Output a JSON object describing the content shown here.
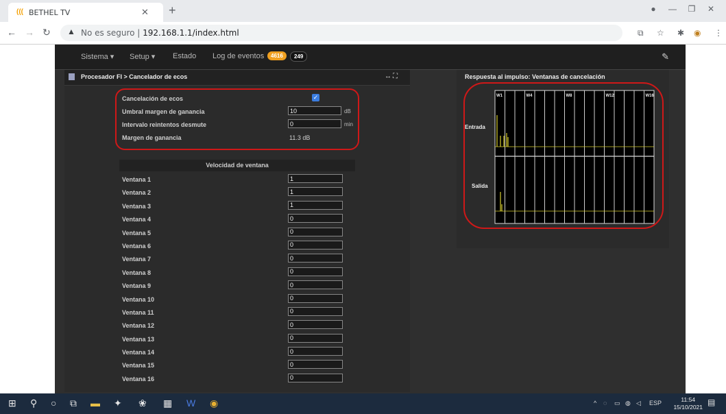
{
  "browser": {
    "tab_title": "BETHEL TV",
    "tab_icon_text": "(((",
    "security_label": "No es seguro",
    "url": "192.168.1.1/index.html"
  },
  "nav": {
    "items": [
      "Sistema ▾",
      "Setup ▾",
      "Estado",
      "Log de eventos"
    ],
    "badge_orange": "4616",
    "badge_dark": "249",
    "colors": {
      "orange": "#f0a020",
      "dark": "#1a1a1a"
    }
  },
  "left_panel": {
    "title": "Procesador FI > Cancelador de ecos",
    "settings": {
      "echo_cancel_label": "Cancelación de ecos",
      "echo_cancel_checked": true,
      "gain_threshold_label": "Umbral margen de ganancia",
      "gain_threshold_value": "10",
      "gain_threshold_unit": "dB",
      "retry_interval_label": "Intervalo reintentos desmute",
      "retry_interval_value": "0",
      "retry_interval_unit": "min",
      "gain_margin_label": "Margen de ganancia",
      "gain_margin_value": "11.3 dB"
    },
    "window_speed_header": "Velocidad de ventana",
    "windows": [
      {
        "label": "Ventana 1",
        "value": "1"
      },
      {
        "label": "Ventana 2",
        "value": "1"
      },
      {
        "label": "Ventana 3",
        "value": "1"
      },
      {
        "label": "Ventana 4",
        "value": "0"
      },
      {
        "label": "Ventana 5",
        "value": "0"
      },
      {
        "label": "Ventana 6",
        "value": "0"
      },
      {
        "label": "Ventana 7",
        "value": "0"
      },
      {
        "label": "Ventana 8",
        "value": "0"
      },
      {
        "label": "Ventana 9",
        "value": "0"
      },
      {
        "label": "Ventana 10",
        "value": "0"
      },
      {
        "label": "Ventana 11",
        "value": "0"
      },
      {
        "label": "Ventana 12",
        "value": "0"
      },
      {
        "label": "Ventana 13",
        "value": "0"
      },
      {
        "label": "Ventana 14",
        "value": "0"
      },
      {
        "label": "Ventana 15",
        "value": "0"
      },
      {
        "label": "Ventana 16",
        "value": "0"
      }
    ]
  },
  "right_panel": {
    "title": "Respuesta al impulso: Ventanas de cancelación",
    "window_labels": [
      "W1",
      "W4",
      "W8",
      "W12",
      "W16"
    ],
    "input_label": "Entrada",
    "output_label": "Salida",
    "trace_color": "#d8d030"
  },
  "taskbar": {
    "lang": "ESP",
    "time": "11:54",
    "date": "15/10/2021"
  }
}
